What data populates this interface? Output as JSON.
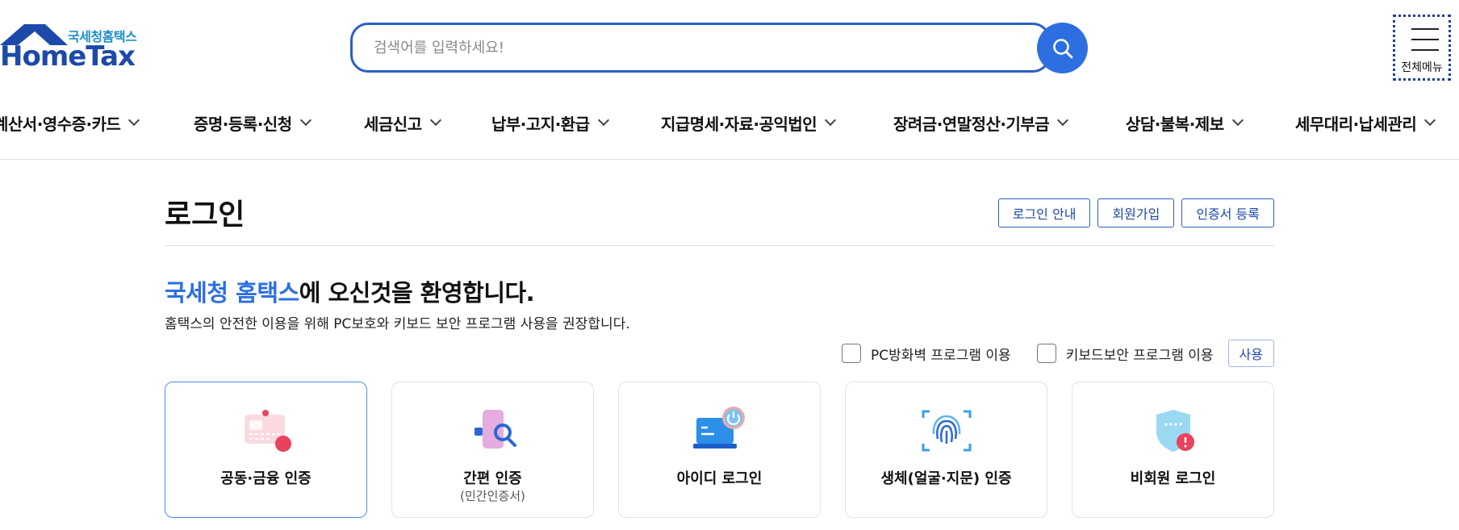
{
  "header": {
    "logo_sub": "국세청홈택스",
    "logo_main": "HomeTax",
    "search_placeholder": "검색어를 입력하세요!",
    "all_menu_label": "전체메뉴"
  },
  "nav": {
    "items": [
      {
        "label": "계산서·영수증·카드"
      },
      {
        "label": "증명·등록·신청"
      },
      {
        "label": "세금신고"
      },
      {
        "label": "납부·고지·환급"
      },
      {
        "label": "지급명세·자료·공익법인"
      },
      {
        "label": "장려금·연말정산·기부금"
      },
      {
        "label": "상담·불복·제보"
      },
      {
        "label": "세무대리·납세관리"
      }
    ]
  },
  "main": {
    "title": "로그인",
    "buttons": {
      "login_guide": "로그인 안내",
      "signup": "회원가입",
      "cert_register": "인증서 등록"
    },
    "welcome_highlight": "국세청 홈택스",
    "welcome_rest": "에 오신것을 환영합니다.",
    "recommend": "홈택스의 안전한 이용을 위해 PC보호와 키보드 보안 프로그램 사용을 권장합니다.",
    "options": {
      "firewall": "PC방화벽 프로그램 이용",
      "keyboard": "키보드보안 프로그램 이용",
      "use": "사용"
    },
    "cards": [
      {
        "label": "공동·금융 인증",
        "icon": "certificate-card-icon"
      },
      {
        "label": "간편 인증",
        "sublabel": "(민간인증서)",
        "icon": "phone-magnifier-icon"
      },
      {
        "label": "아이디 로그인",
        "icon": "laptop-power-icon"
      },
      {
        "label": "생체(얼굴·지문) 인증",
        "icon": "fingerprint-icon"
      },
      {
        "label": "비회원 로그인",
        "icon": "shield-alert-icon"
      }
    ]
  },
  "colors": {
    "accent": "#2d6fe0",
    "brand_navy": "#1d4aa8",
    "brand_teal": "#1f8fc9"
  }
}
